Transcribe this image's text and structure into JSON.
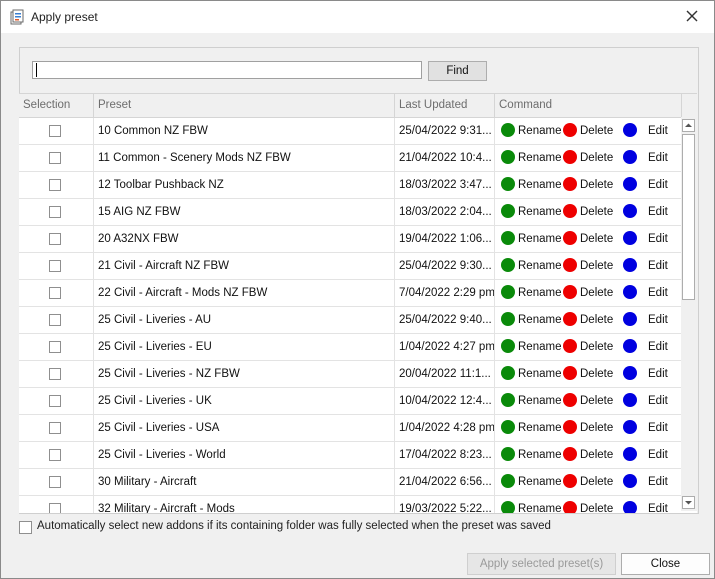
{
  "window": {
    "title": "Apply preset"
  },
  "search": {
    "value": "",
    "find_label": "Find"
  },
  "table": {
    "columns": [
      "Selection",
      "Preset",
      "Last Updated",
      "Command"
    ],
    "rows": [
      {
        "preset": "10 Common NZ FBW",
        "updated": "25/04/2022 9:31..."
      },
      {
        "preset": "11 Common - Scenery Mods NZ FBW",
        "updated": "21/04/2022 10:4..."
      },
      {
        "preset": "12 Toolbar Pushback NZ",
        "updated": "18/03/2022 3:47..."
      },
      {
        "preset": "15 AIG NZ FBW",
        "updated": "18/03/2022 2:04..."
      },
      {
        "preset": "20 A32NX FBW",
        "updated": "19/04/2022 1:06..."
      },
      {
        "preset": "21 Civil - Aircraft NZ FBW",
        "updated": "25/04/2022 9:30..."
      },
      {
        "preset": "22 Civil - Aircraft - Mods NZ FBW",
        "updated": "7/04/2022 2:29 pm"
      },
      {
        "preset": "25 Civil - Liveries - AU",
        "updated": "25/04/2022 9:40..."
      },
      {
        "preset": "25 Civil - Liveries - EU",
        "updated": "1/04/2022 4:27 pm"
      },
      {
        "preset": "25 Civil - Liveries - NZ FBW",
        "updated": "20/04/2022 11:1..."
      },
      {
        "preset": "25 Civil - Liveries - UK",
        "updated": "10/04/2022 12:4..."
      },
      {
        "preset": "25 Civil - Liveries - USA",
        "updated": "1/04/2022 4:28 pm"
      },
      {
        "preset": "25 Civil - Liveries - World",
        "updated": "17/04/2022 8:23..."
      },
      {
        "preset": "30 Military - Aircraft",
        "updated": "21/04/2022 6:56..."
      },
      {
        "preset": "32 Military - Aircraft - Mods",
        "updated": "19/03/2022 5:22..."
      }
    ],
    "commands": {
      "rename": {
        "label": "Rename",
        "color": "#0a8a0a"
      },
      "delete": {
        "label": "Delete",
        "color": "#ee0000"
      },
      "edit": {
        "label": "Edit",
        "color": "#0000e0"
      }
    }
  },
  "options": {
    "auto_select_label": "Automatically select new addons if its containing folder was fully selected when the preset was saved"
  },
  "buttons": {
    "apply": "Apply selected preset(s)",
    "close": "Close"
  }
}
